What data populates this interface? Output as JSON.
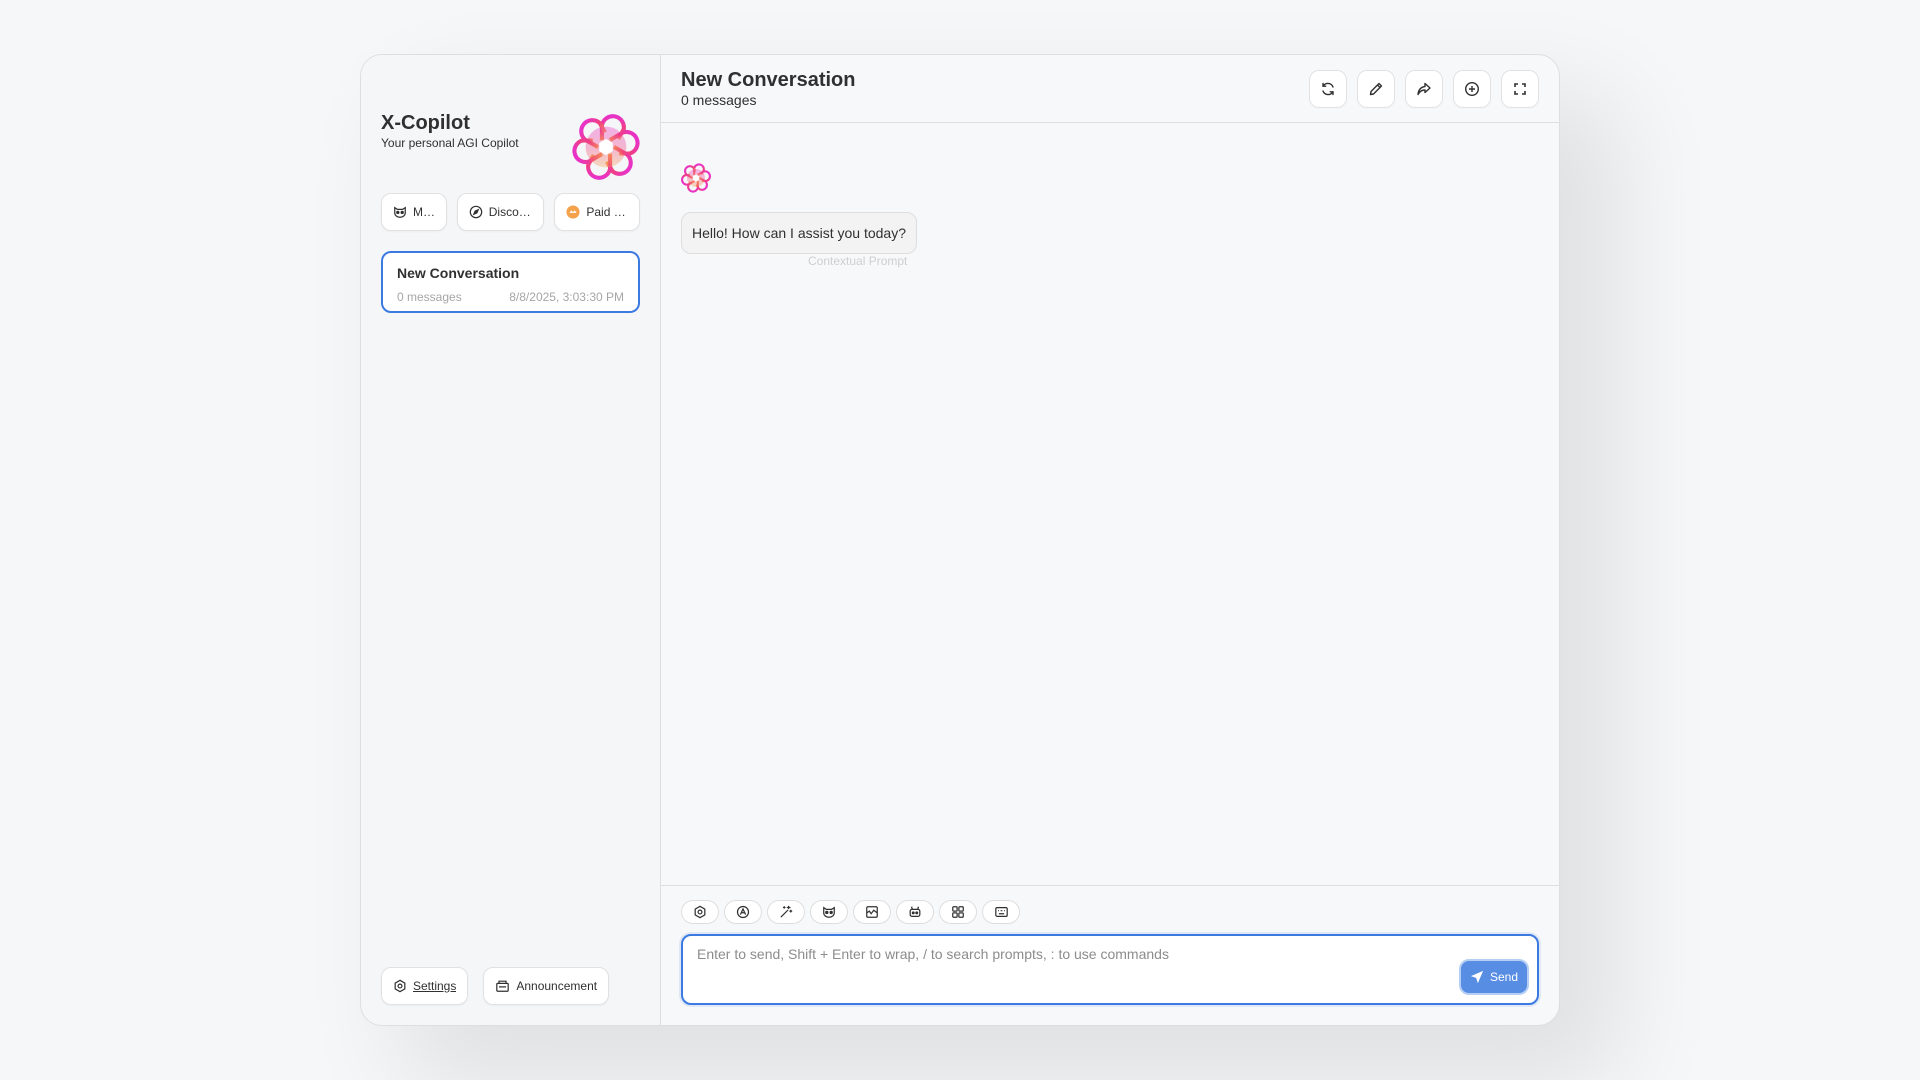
{
  "app": {
    "title": "X-Copilot",
    "subtitle": "Your personal AGI Copilot"
  },
  "sidebar": {
    "actions": [
      {
        "label": "M…",
        "icon": "mask-icon"
      },
      {
        "label": "Disco…",
        "icon": "discovery-icon"
      },
      {
        "label": "Paid …",
        "icon": "coin-icon"
      }
    ],
    "sessions": [
      {
        "title": "New Conversation",
        "count": "0 messages",
        "date": "8/8/2025, 3:03:30 PM"
      }
    ],
    "footer": {
      "settings_label": "Settings",
      "announcement_label": "Announcement"
    }
  },
  "chat": {
    "title": "New Conversation",
    "subtitle": "0 messages",
    "header_actions": [
      "refresh-icon",
      "edit-icon",
      "share-icon",
      "add-icon",
      "fullscreen-icon"
    ],
    "messages": [
      {
        "role": "assistant",
        "text": "Hello! How can I assist you today?",
        "hint": "Contextual Prompt"
      }
    ],
    "input_actions": [
      "settings-icon",
      "theme-icon",
      "prompt-icon",
      "mask-icon",
      "clear-context-icon",
      "robot-icon",
      "plugin-icon",
      "shortcut-icon"
    ],
    "input": {
      "placeholder": "Enter to send, Shift + Enter to wrap, / to search prompts, : to use commands",
      "value": "",
      "send_label": "Send"
    }
  },
  "colors": {
    "accent": "#3b7ae0",
    "background": "#f6f7f9",
    "border": "#dedede"
  }
}
